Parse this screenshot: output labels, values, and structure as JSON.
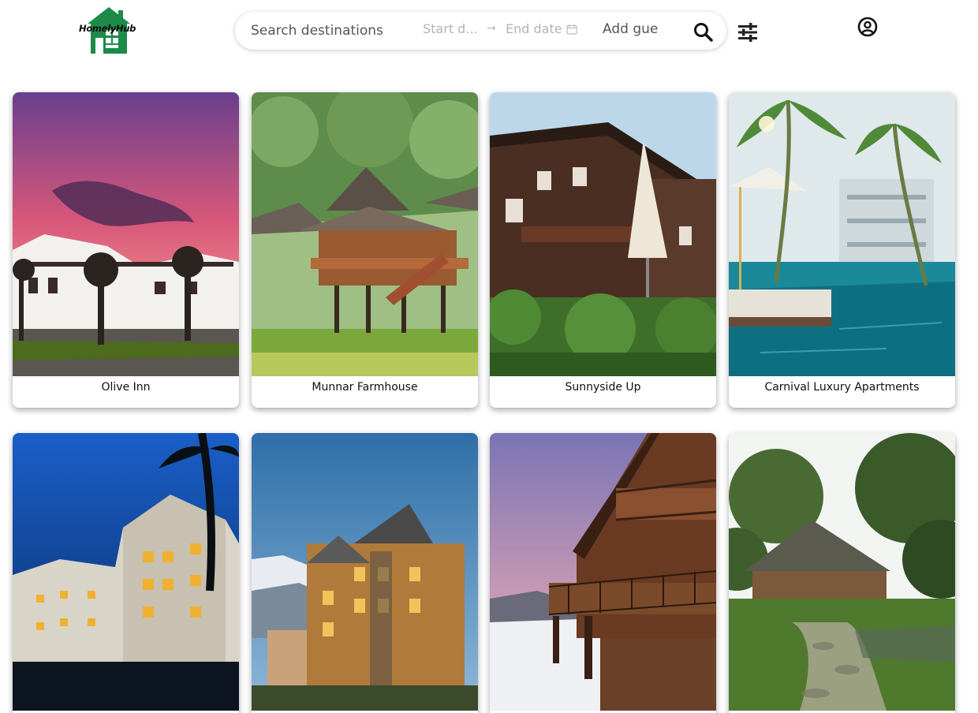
{
  "brand": {
    "name": "HomelyHub"
  },
  "search": {
    "destination_placeholder": "Search destinations",
    "start_date_placeholder": "Start d...",
    "date_separator": "→",
    "end_date_placeholder": "End date",
    "guests_placeholder": "Add gue"
  },
  "icons": {
    "search": "search-icon",
    "filter": "filter-sliders-icon",
    "user": "user-circle-icon",
    "calendar": "calendar-icon"
  },
  "colors": {
    "brand_green": "#1e8a4a",
    "text_dark": "#111111"
  },
  "listings": [
    {
      "title": "Olive Inn"
    },
    {
      "title": "Munnar Farmhouse"
    },
    {
      "title": "Sunnyside Up"
    },
    {
      "title": "Carnival Luxury Apartments"
    },
    {
      "title": ""
    },
    {
      "title": ""
    },
    {
      "title": ""
    },
    {
      "title": ""
    }
  ]
}
